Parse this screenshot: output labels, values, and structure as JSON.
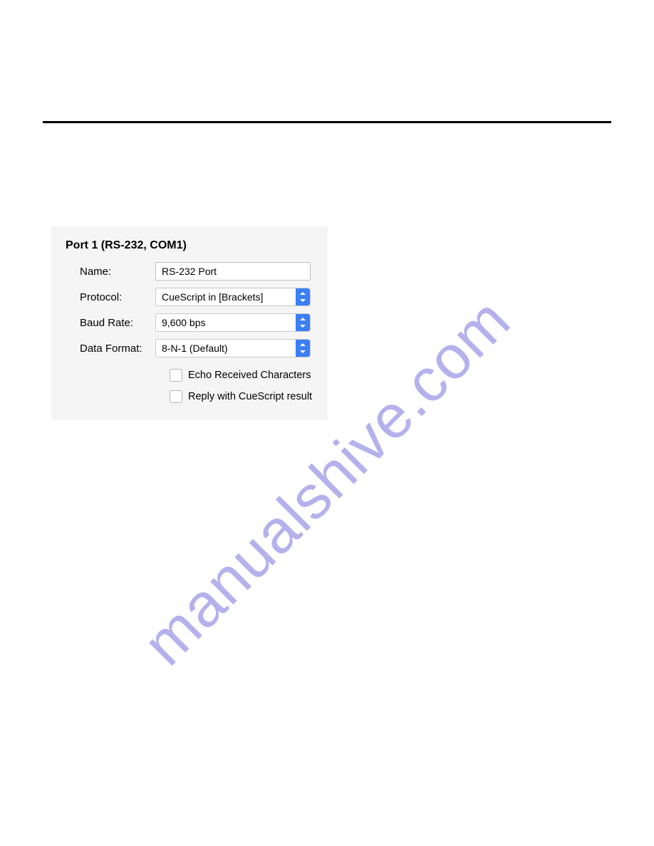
{
  "watermark": "manualshive.com",
  "panel": {
    "title": "Port 1 (RS-232, COM1)",
    "name_label": "Name:",
    "name_value": "RS-232 Port",
    "protocol_label": "Protocol:",
    "protocol_value": "CueScript in [Brackets]",
    "baud_label": "Baud Rate:",
    "baud_value": "9,600 bps",
    "format_label": "Data Format:",
    "format_value": "8-N-1 (Default)",
    "echo_label": "Echo Received Characters",
    "reply_label": "Reply with CueScript result"
  }
}
